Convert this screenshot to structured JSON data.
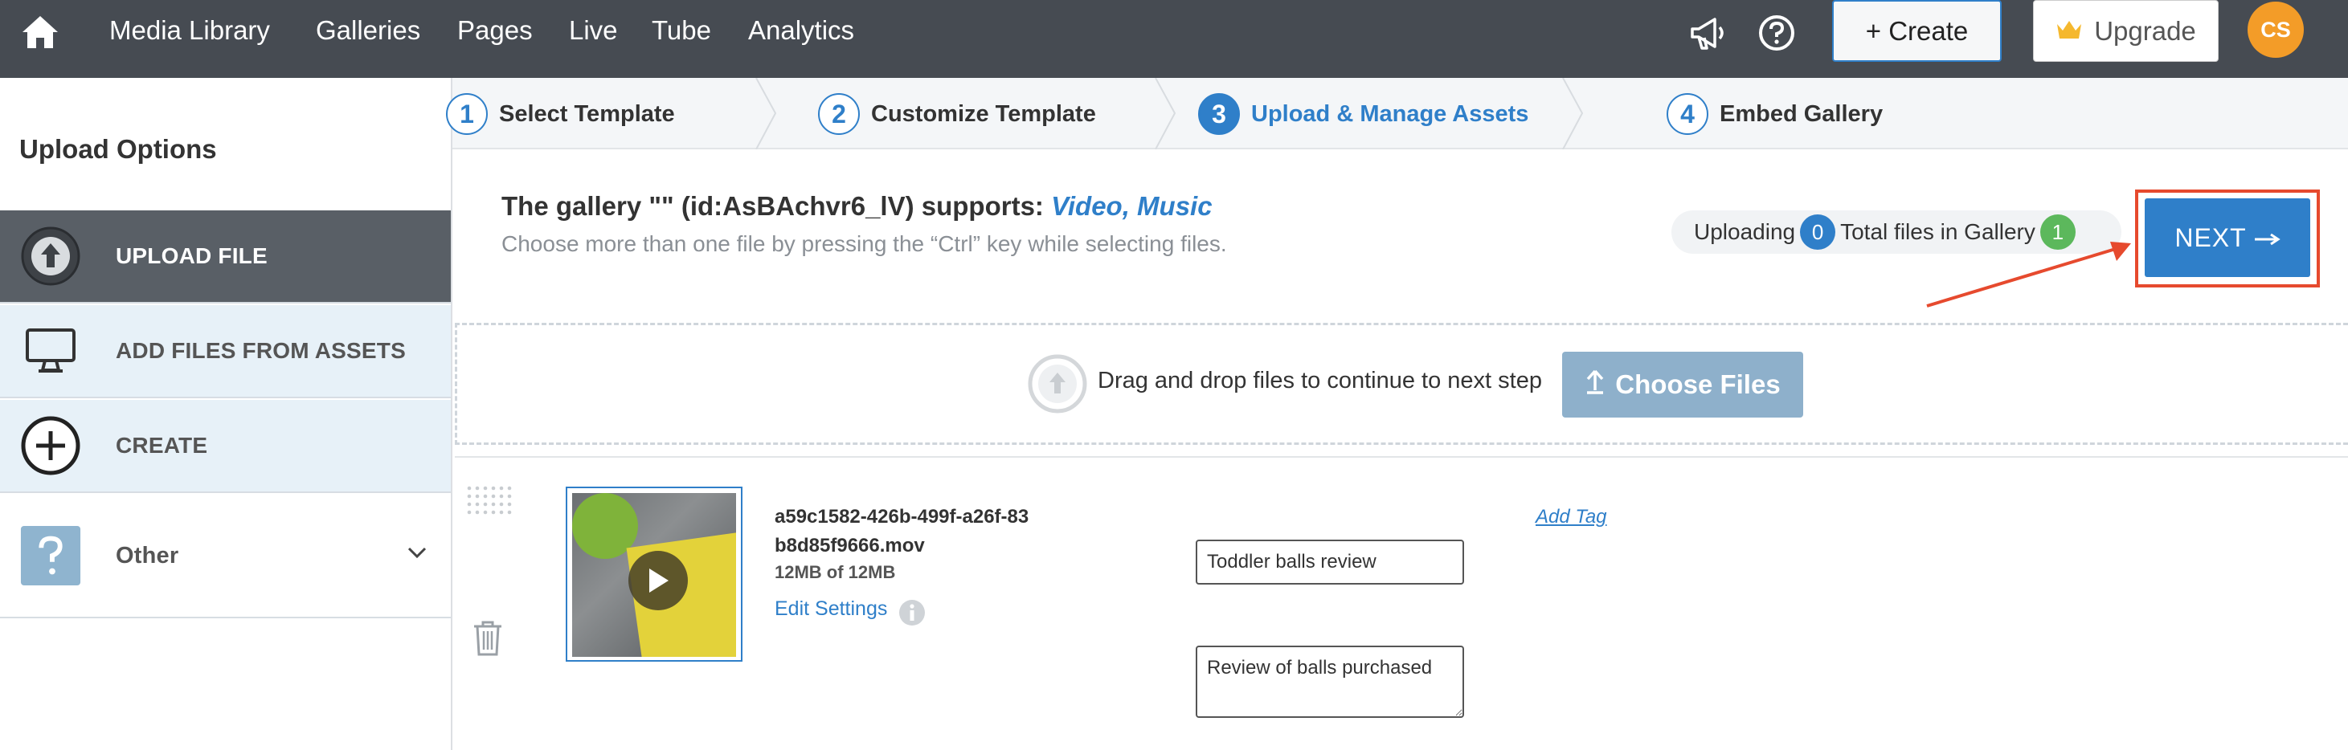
{
  "topnav": {
    "items": [
      "Media Library",
      "Galleries",
      "Pages",
      "Live",
      "Tube",
      "Analytics"
    ],
    "create_label": "+ Create",
    "upgrade_label": "Upgrade",
    "avatar_initials": "CS"
  },
  "sidebar": {
    "title": "Upload Options",
    "items": [
      {
        "label": "UPLOAD FILE",
        "icon": "upload-circle-icon"
      },
      {
        "label": "ADD FILES FROM ASSETS",
        "icon": "monitor-icon"
      },
      {
        "label": "CREATE",
        "icon": "plus-circle-icon"
      },
      {
        "label": "Other",
        "icon": "question-icon"
      }
    ]
  },
  "steps": [
    {
      "num": "1",
      "label": "Select Template"
    },
    {
      "num": "2",
      "label": "Customize Template"
    },
    {
      "num": "3",
      "label": "Upload & Manage Assets"
    },
    {
      "num": "4",
      "label": "Embed Gallery"
    }
  ],
  "gallery": {
    "heading_prefix": "The gallery \"\" (id:AsBAchvr6_lV) supports: ",
    "supported_types": "Video, Music",
    "hint": "Choose more than one file by pressing the “Ctrl” key while selecting files."
  },
  "status": {
    "uploading_label": "Uploading",
    "uploading_count": "0",
    "total_label": "Total files in Gallery",
    "total_count": "1"
  },
  "next_label": "NEXT",
  "dropzone": {
    "text": "Drag and drop files to continue to next step",
    "button_label": "Choose Files"
  },
  "file": {
    "name": "a59c1582-426b-499f-a26f-83b8d85f9666.mov",
    "size": "12MB of 12MB",
    "edit_settings": "Edit Settings",
    "title_value": "Toddler balls review",
    "description_value": "Review of balls purchased",
    "add_tag": "Add Tag"
  },
  "colors": {
    "topbar": "#464b52",
    "accent": "#2f7fc9",
    "highlight": "#e64a2e",
    "avatar": "#f39c28",
    "success": "#5cb85c"
  }
}
